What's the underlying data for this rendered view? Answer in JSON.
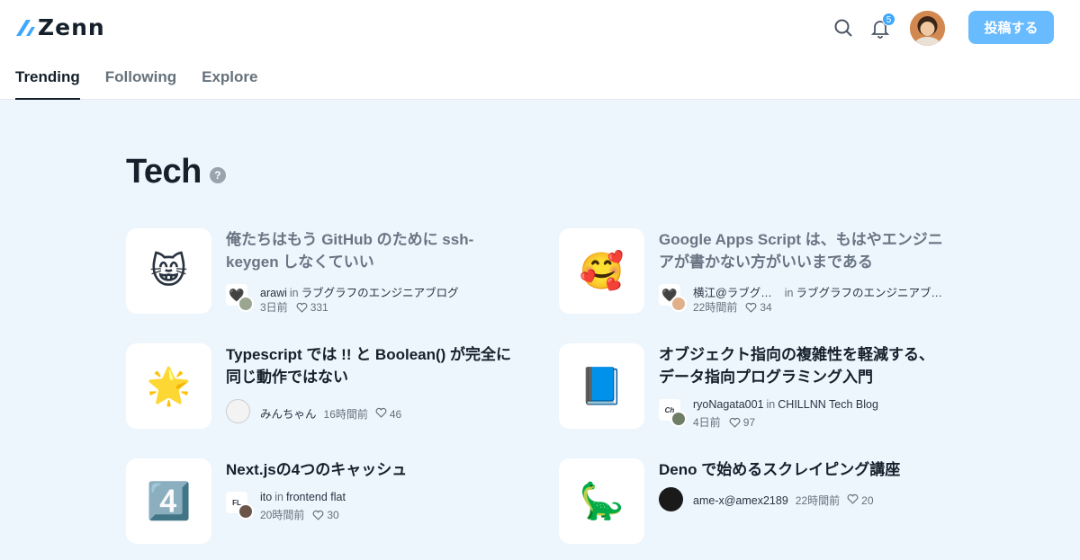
{
  "brand": {
    "name": "Zenn"
  },
  "header": {
    "search_icon": "search-icon",
    "notifications": {
      "icon": "bell-icon",
      "count": "5"
    },
    "post_button": "投稿する"
  },
  "tabs": [
    {
      "label": "Trending",
      "active": true
    },
    {
      "label": "Following",
      "active": false
    },
    {
      "label": "Explore",
      "active": false
    }
  ],
  "section": {
    "title": "Tech",
    "help": "?"
  },
  "articles": [
    {
      "emoji": "😸",
      "title": "俺たちはもう GitHub のために ssh-keygen しなくていい",
      "author": "arawi",
      "in": "in",
      "publication": "ラブグラフのエンジニアブログ",
      "time": "3日前",
      "likes": "331"
    },
    {
      "emoji": "🥰",
      "title": "Google Apps Script は、もはやエンジニアが書かない方がいいまである",
      "author": "横江@ラブグ…",
      "in": "in",
      "publication": "ラブグラフのエンジニアブ…",
      "time": "22時間前",
      "likes": "34"
    },
    {
      "emoji": "🌟",
      "title": "Typescript では !! と Boolean() が完全に同じ動作ではない",
      "author": "みんちゃん",
      "time": "16時間前",
      "likes": "46"
    },
    {
      "emoji": "📘",
      "title": "オブジェクト指向の複雑性を軽減する、データ指向プログラミング入門",
      "author": "ryoNagata001",
      "in": "in",
      "publication": "CHILLNN Tech Blog",
      "time": "4日前",
      "likes": "97"
    },
    {
      "emoji": "4️⃣",
      "title": "Next.jsの4つのキャッシュ",
      "author": "ito",
      "in": "in",
      "publication": "frontend flat",
      "time": "20時間前",
      "likes": "30"
    },
    {
      "emoji": "🦕",
      "title": "Deno で始めるスクレイピング講座",
      "author": "ame-x@amex2189",
      "time": "22時間前",
      "likes": "20"
    }
  ]
}
